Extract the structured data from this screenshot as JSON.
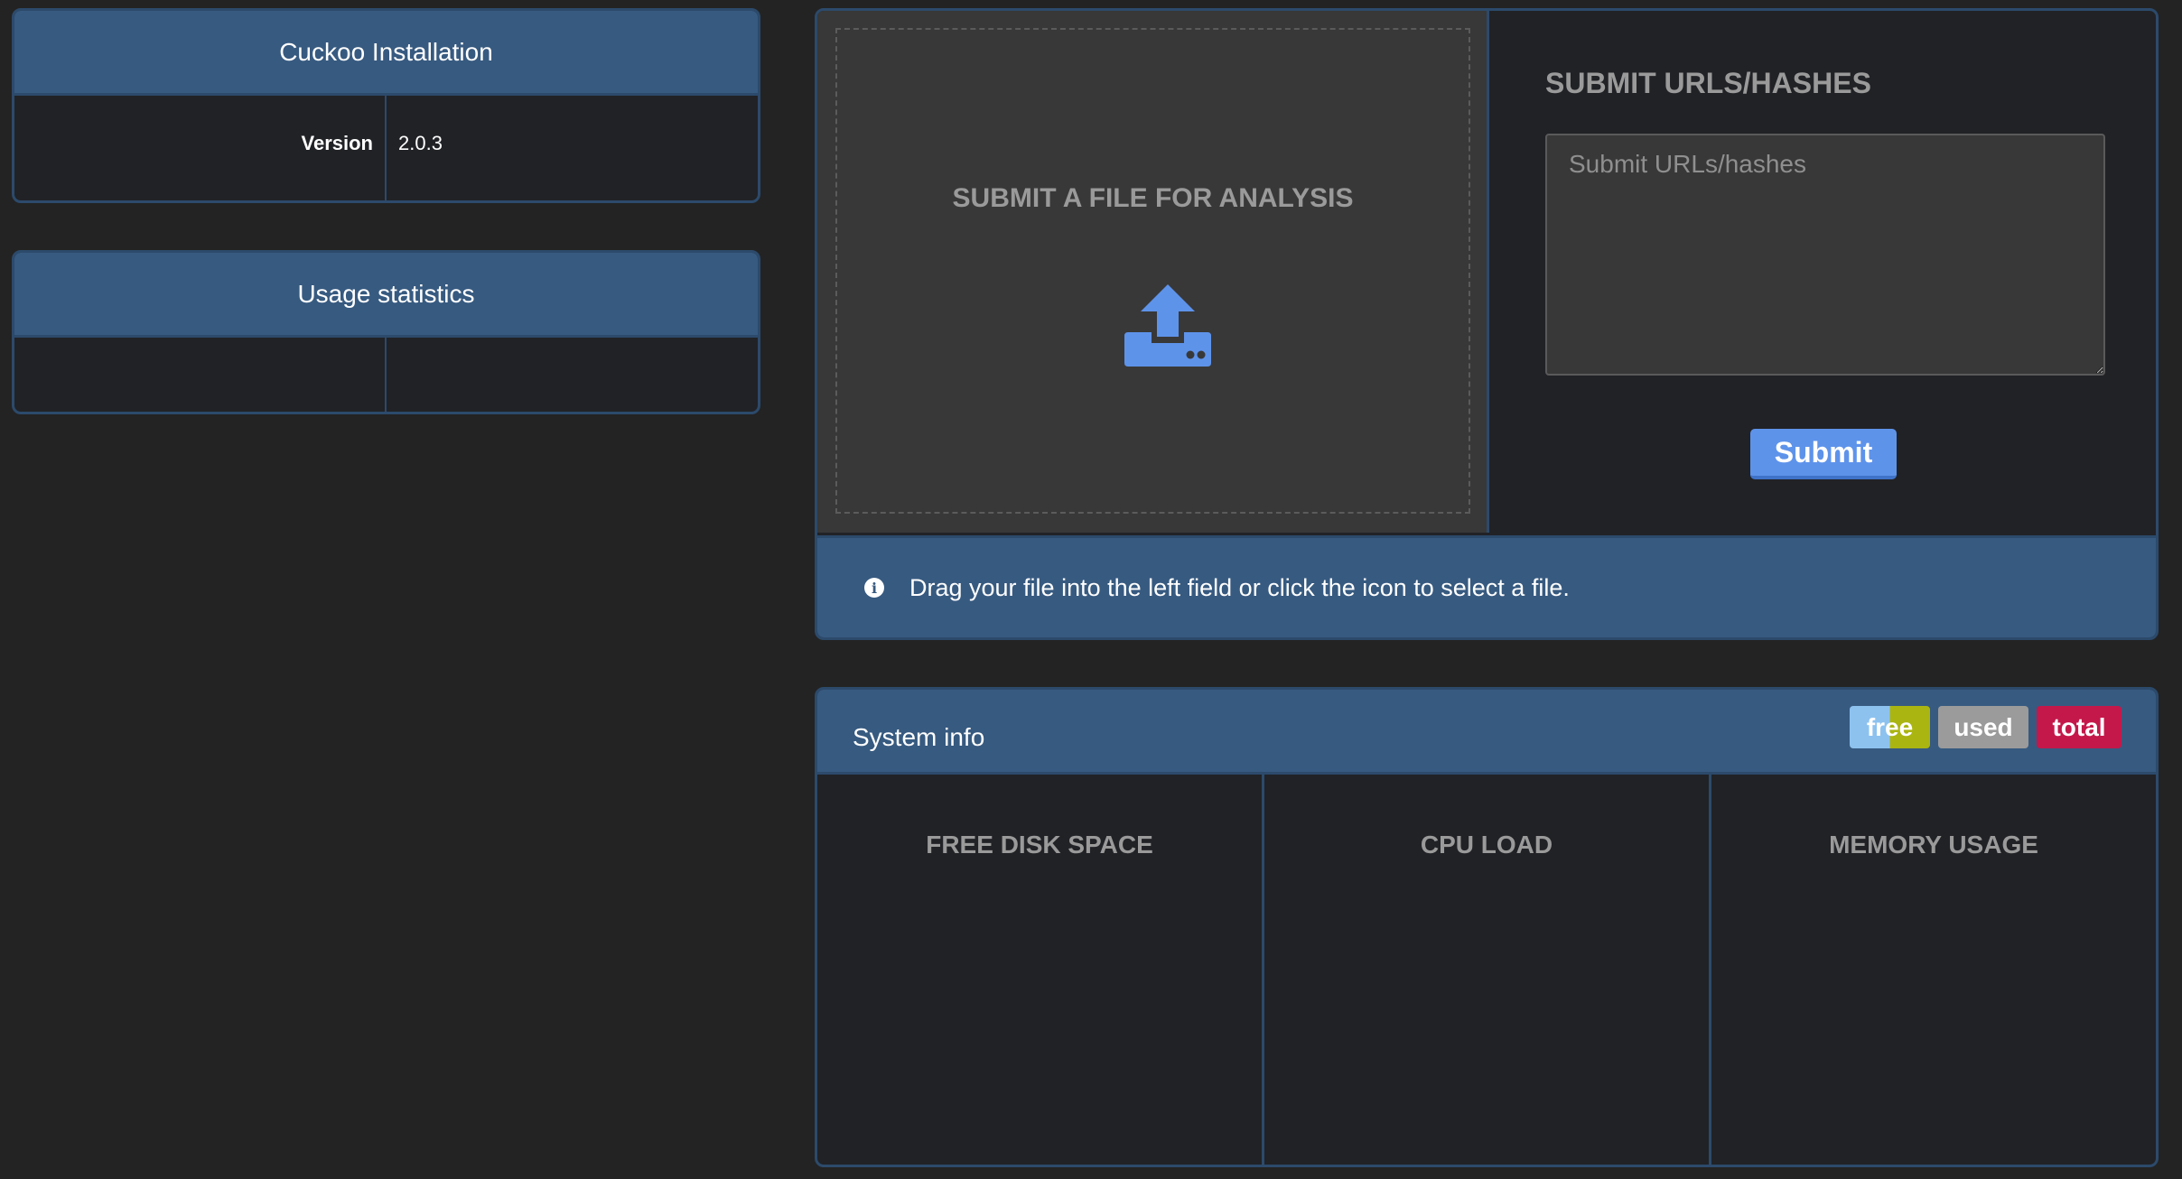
{
  "installation": {
    "title": "Cuckoo Installation",
    "version_label": "Version",
    "version_value": "2.0.3"
  },
  "usage": {
    "title": "Usage statistics"
  },
  "submit_file": {
    "title": "SUBMIT A FILE FOR ANALYSIS",
    "icon": "upload-icon"
  },
  "submit_urls": {
    "title": "SUBMIT URLS/HASHES",
    "placeholder": "Submit URLs/hashes",
    "value": "",
    "button_label": "Submit"
  },
  "info_bar": {
    "icon": "info-icon",
    "text": "Drag your file into the left field or click the icon to select a file."
  },
  "system_info": {
    "title": "System info",
    "legend": {
      "free": "free",
      "used": "used",
      "total": "total"
    },
    "columns": [
      "FREE DISK SPACE",
      "CPU LOAD",
      "MEMORY USAGE"
    ]
  },
  "colors": {
    "background": "#232323",
    "panel_header": "#375a80",
    "accent": "#5e93ea",
    "free_light": "#8dc2ef",
    "free_dark": "#aab512",
    "used": "#9b9b9b",
    "total": "#c4184a"
  }
}
